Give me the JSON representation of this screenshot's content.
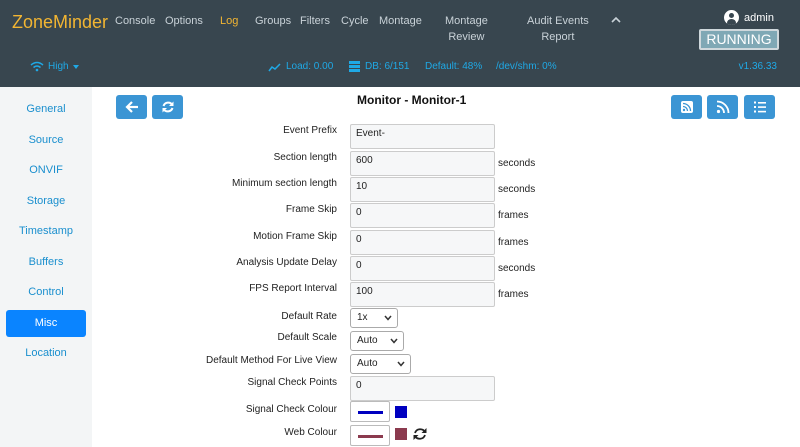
{
  "header": {
    "brand": "ZoneMinder",
    "nav": [
      {
        "label": "Console",
        "active": false
      },
      {
        "label": "Options",
        "active": false
      },
      {
        "label": "Log",
        "active": true
      },
      {
        "label": "Groups",
        "active": false
      },
      {
        "label": "Filters",
        "active": false
      },
      {
        "label": "Cycle",
        "active": false
      },
      {
        "label": "Montage",
        "active": false
      },
      {
        "label": "Montage Review",
        "line1": "Montage",
        "line2": "Review",
        "active": false
      },
      {
        "label": "Audit Events Report",
        "line1": "Audit Events",
        "line2": "Report",
        "active": false
      }
    ],
    "user": "admin",
    "state": "RUNNING"
  },
  "status": {
    "bandwidth": "High",
    "load": "Load: 0.00",
    "db": "DB: 6/151",
    "default_storage": "Default: 48%",
    "shm": "/dev/shm: 0%",
    "version": "v1.36.33"
  },
  "sidebar": {
    "items": [
      {
        "label": "General",
        "active": false
      },
      {
        "label": "Source",
        "active": false
      },
      {
        "label": "ONVIF",
        "active": false
      },
      {
        "label": "Storage",
        "active": false
      },
      {
        "label": "Timestamp",
        "active": false
      },
      {
        "label": "Buffers",
        "active": false
      },
      {
        "label": "Control",
        "active": false
      },
      {
        "label": "Misc",
        "active": true
      },
      {
        "label": "Location",
        "active": false
      }
    ]
  },
  "page": {
    "title": "Monitor - Monitor-1"
  },
  "form": {
    "event_prefix": {
      "label": "Event Prefix",
      "value": "Event-"
    },
    "section_length": {
      "label": "Section length",
      "value": "600",
      "unit": "seconds"
    },
    "min_section_length": {
      "label": "Minimum section length",
      "value": "10",
      "unit": "seconds"
    },
    "frame_skip": {
      "label": "Frame Skip",
      "value": "0",
      "unit": "frames"
    },
    "motion_frame_skip": {
      "label": "Motion Frame Skip",
      "value": "0",
      "unit": "frames"
    },
    "analysis_update_delay": {
      "label": "Analysis Update Delay",
      "value": "0",
      "unit": "seconds"
    },
    "fps_report_interval": {
      "label": "FPS Report Interval",
      "value": "100",
      "unit": "frames"
    },
    "default_rate": {
      "label": "Default Rate",
      "value": "1x"
    },
    "default_scale": {
      "label": "Default Scale",
      "value": "Auto"
    },
    "default_method": {
      "label": "Default Method For Live View",
      "value": "Auto"
    },
    "signal_check_points": {
      "label": "Signal Check Points",
      "value": "0"
    },
    "signal_check_colour": {
      "label": "Signal Check Colour",
      "color": "#0000c0"
    },
    "web_colour": {
      "label": "Web Colour",
      "color": "#8b3a4e"
    }
  },
  "colors": {
    "header_bg": "#38464f",
    "brand": "#f2b532",
    "accent": "#1fa9e6",
    "button": "#3b95d4",
    "active_tab": "#0a84ff"
  }
}
